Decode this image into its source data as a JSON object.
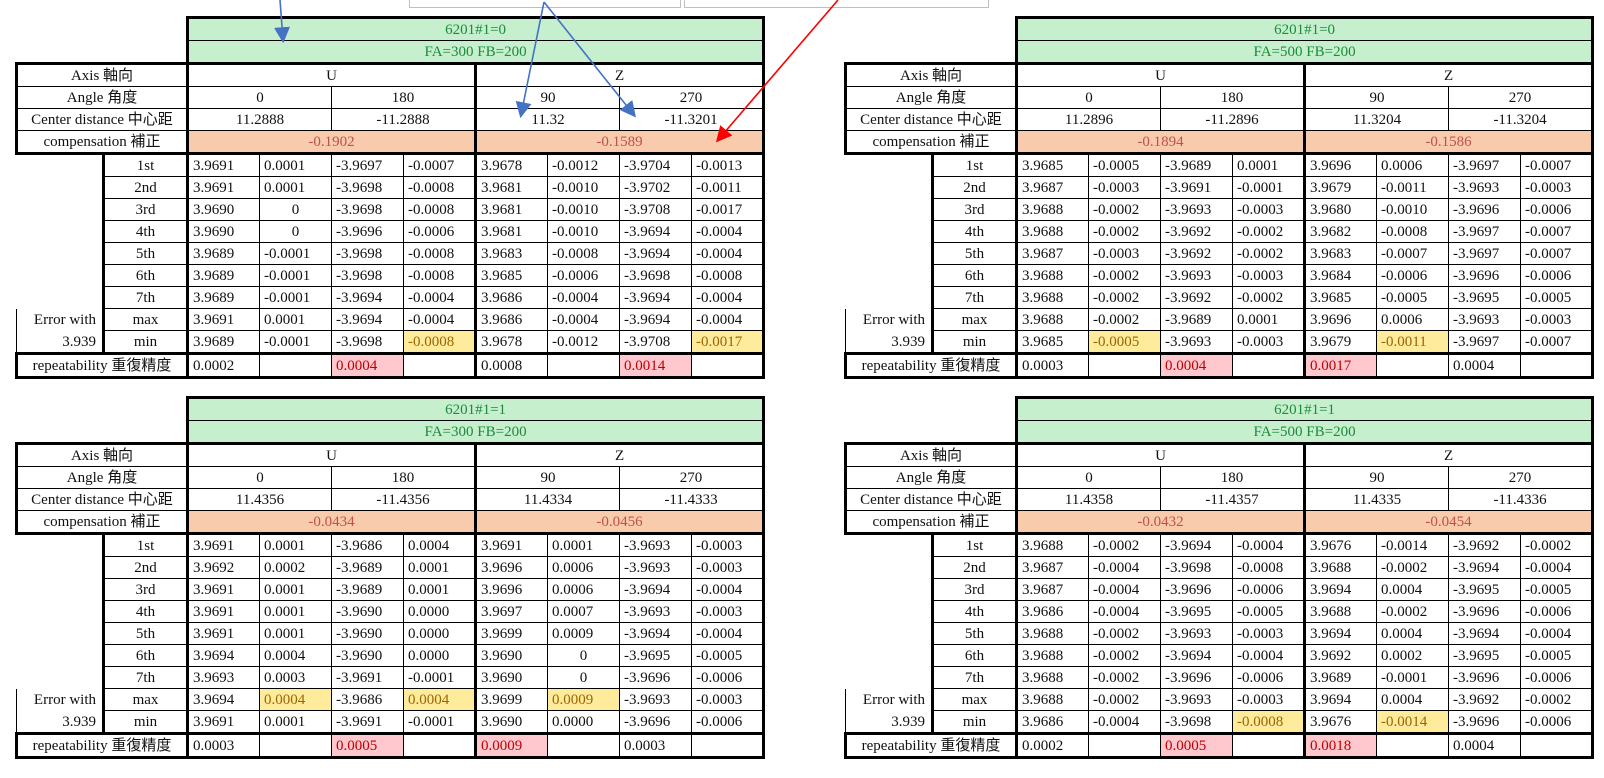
{
  "tables": [
    {
      "param": "6201#1=0",
      "feed": "FA=300 FB=200",
      "axis_label": "Axis 軸向",
      "angle_label": "Angle 角度",
      "center_label": "Center distance 中心距",
      "comp_label": "compensation 補正",
      "error_label": "Error with",
      "error_value": "3.939",
      "repeat_label": "repeatability 重復精度",
      "axes": [
        "U",
        "Z"
      ],
      "angles": [
        "0",
        "180",
        "90",
        "270"
      ],
      "center": [
        "11.2888",
        "-11.2888",
        "11.32",
        "-11.3201"
      ],
      "comp": [
        "-0.1902",
        "-0.1589"
      ],
      "rows": [
        {
          "label": "1st",
          "v": [
            "3.9691",
            "0.0001",
            "-3.9697",
            "-0.0007",
            "3.9678",
            "-0.0012",
            "-3.9704",
            "-0.0013"
          ]
        },
        {
          "label": "2nd",
          "v": [
            "3.9691",
            "0.0001",
            "-3.9698",
            "-0.0008",
            "3.9681",
            "-0.0010",
            "-3.9702",
            "-0.0011"
          ]
        },
        {
          "label": "3rd",
          "v": [
            "3.9690",
            "0",
            "-3.9698",
            "-0.0008",
            "3.9681",
            "-0.0010",
            "-3.9708",
            "-0.0017"
          ]
        },
        {
          "label": "4th",
          "v": [
            "3.9690",
            "0",
            "-3.9696",
            "-0.0006",
            "3.9681",
            "-0.0010",
            "-3.9694",
            "-0.0004"
          ]
        },
        {
          "label": "5th",
          "v": [
            "3.9689",
            "-0.0001",
            "-3.9698",
            "-0.0008",
            "3.9683",
            "-0.0008",
            "-3.9694",
            "-0.0004"
          ]
        },
        {
          "label": "6th",
          "v": [
            "3.9689",
            "-0.0001",
            "-3.9698",
            "-0.0008",
            "3.9685",
            "-0.0006",
            "-3.9698",
            "-0.0008"
          ]
        },
        {
          "label": "7th",
          "v": [
            "3.9689",
            "-0.0001",
            "-3.9694",
            "-0.0004",
            "3.9686",
            "-0.0004",
            "-3.9694",
            "-0.0004"
          ]
        }
      ],
      "max": {
        "label": "max",
        "v": [
          "3.9691",
          "0.0001",
          "-3.9694",
          "-0.0004",
          "3.9686",
          "-0.0004",
          "-3.9694",
          "-0.0004"
        ]
      },
      "min": {
        "label": "min",
        "v": [
          "3.9689",
          "-0.0001",
          "-3.9698",
          "-0.0008",
          "3.9678",
          "-0.0012",
          "-3.9708",
          "-0.0017"
        ]
      },
      "repeat": [
        "0.0002",
        "0.0004",
        "0.0008",
        "0.0014"
      ]
    },
    {
      "param": "6201#1=0",
      "feed": "FA=500 FB=200",
      "axis_label": "Axis 軸向",
      "angle_label": "Angle 角度",
      "center_label": "Center distance 中心距",
      "comp_label": "compensation 補正",
      "error_label": "Error with",
      "error_value": "3.939",
      "repeat_label": "repeatability 重復精度",
      "axes": [
        "U",
        "Z"
      ],
      "angles": [
        "0",
        "180",
        "90",
        "270"
      ],
      "center": [
        "11.2896",
        "-11.2896",
        "11.3204",
        "-11.3204"
      ],
      "comp": [
        "-0.1894",
        "-0.1586"
      ],
      "rows": [
        {
          "label": "1st",
          "v": [
            "3.9685",
            "-0.0005",
            "-3.9689",
            "0.0001",
            "3.9696",
            "0.0006",
            "-3.9697",
            "-0.0007"
          ]
        },
        {
          "label": "2nd",
          "v": [
            "3.9687",
            "-0.0003",
            "-3.9691",
            "-0.0001",
            "3.9679",
            "-0.0011",
            "-3.9693",
            "-0.0003"
          ]
        },
        {
          "label": "3rd",
          "v": [
            "3.9688",
            "-0.0002",
            "-3.9693",
            "-0.0003",
            "3.9680",
            "-0.0010",
            "-3.9696",
            "-0.0006"
          ]
        },
        {
          "label": "4th",
          "v": [
            "3.9688",
            "-0.0002",
            "-3.9692",
            "-0.0002",
            "3.9682",
            "-0.0008",
            "-3.9697",
            "-0.0007"
          ]
        },
        {
          "label": "5th",
          "v": [
            "3.9687",
            "-0.0003",
            "-3.9692",
            "-0.0002",
            "3.9683",
            "-0.0007",
            "-3.9697",
            "-0.0007"
          ]
        },
        {
          "label": "6th",
          "v": [
            "3.9688",
            "-0.0002",
            "-3.9693",
            "-0.0003",
            "3.9684",
            "-0.0006",
            "-3.9696",
            "-0.0006"
          ]
        },
        {
          "label": "7th",
          "v": [
            "3.9688",
            "-0.0002",
            "-3.9692",
            "-0.0002",
            "3.9685",
            "-0.0005",
            "-3.9695",
            "-0.0005"
          ]
        }
      ],
      "max": {
        "label": "max",
        "v": [
          "3.9688",
          "-0.0002",
          "-3.9689",
          "0.0001",
          "3.9696",
          "0.0006",
          "-3.9693",
          "-0.0003"
        ]
      },
      "min": {
        "label": "min",
        "v": [
          "3.9685",
          "-0.0005",
          "-3.9693",
          "-0.0003",
          "3.9679",
          "-0.0011",
          "-3.9697",
          "-0.0007"
        ]
      },
      "repeat": [
        "0.0003",
        "0.0004",
        "0.0017",
        "0.0004"
      ]
    },
    {
      "param": "6201#1=1",
      "feed": "FA=300 FB=200",
      "axis_label": "Axis 軸向",
      "angle_label": "Angle 角度",
      "center_label": "Center distance 中心距",
      "comp_label": "compensation 補正",
      "error_label": "Error with",
      "error_value": "3.939",
      "repeat_label": "repeatability 重復精度",
      "axes": [
        "U",
        "Z"
      ],
      "angles": [
        "0",
        "180",
        "90",
        "270"
      ],
      "center": [
        "11.4356",
        "-11.4356",
        "11.4334",
        "-11.4333"
      ],
      "comp": [
        "-0.0434",
        "-0.0456"
      ],
      "rows": [
        {
          "label": "1st",
          "v": [
            "3.9691",
            "0.0001",
            "-3.9686",
            "0.0004",
            "3.9691",
            "0.0001",
            "-3.9693",
            "-0.0003"
          ]
        },
        {
          "label": "2nd",
          "v": [
            "3.9692",
            "0.0002",
            "-3.9689",
            "0.0001",
            "3.9696",
            "0.0006",
            "-3.9693",
            "-0.0003"
          ]
        },
        {
          "label": "3rd",
          "v": [
            "3.9691",
            "0.0001",
            "-3.9689",
            "0.0001",
            "3.9696",
            "0.0006",
            "-3.9694",
            "-0.0004"
          ]
        },
        {
          "label": "4th",
          "v": [
            "3.9691",
            "0.0001",
            "-3.9690",
            "0.0000",
            "3.9697",
            "0.0007",
            "-3.9693",
            "-0.0003"
          ]
        },
        {
          "label": "5th",
          "v": [
            "3.9691",
            "0.0001",
            "-3.9690",
            "0.0000",
            "3.9699",
            "0.0009",
            "-3.9694",
            "-0.0004"
          ]
        },
        {
          "label": "6th",
          "v": [
            "3.9694",
            "0.0004",
            "-3.9690",
            "0.0000",
            "3.9690",
            "0",
            "-3.9695",
            "-0.0005"
          ]
        },
        {
          "label": "7th",
          "v": [
            "3.9693",
            "0.0003",
            "-3.9691",
            "-0.0001",
            "3.9690",
            "0",
            "-3.9696",
            "-0.0006"
          ]
        }
      ],
      "max": {
        "label": "max",
        "v": [
          "3.9694",
          "0.0004",
          "-3.9686",
          "0.0004",
          "3.9699",
          "0.0009",
          "-3.9693",
          "-0.0003"
        ]
      },
      "min": {
        "label": "min",
        "v": [
          "3.9691",
          "0.0001",
          "-3.9691",
          "-0.0001",
          "3.9690",
          "0.0000",
          "-3.9696",
          "-0.0006"
        ]
      },
      "repeat": [
        "0.0003",
        "0.0005",
        "0.0009",
        "0.0003"
      ]
    },
    {
      "param": "6201#1=1",
      "feed": "FA=500 FB=200",
      "axis_label": "Axis 軸向",
      "angle_label": "Angle 角度",
      "center_label": "Center distance 中心距",
      "comp_label": "compensation 補正",
      "error_label": "Error with",
      "error_value": "3.939",
      "repeat_label": "repeatability 重復精度",
      "axes": [
        "U",
        "Z"
      ],
      "angles": [
        "0",
        "180",
        "90",
        "270"
      ],
      "center": [
        "11.4358",
        "-11.4357",
        "11.4335",
        "-11.4336"
      ],
      "comp": [
        "-0.0432",
        "-0.0454"
      ],
      "rows": [
        {
          "label": "1st",
          "v": [
            "3.9688",
            "-0.0002",
            "-3.9694",
            "-0.0004",
            "3.9676",
            "-0.0014",
            "-3.9692",
            "-0.0002"
          ]
        },
        {
          "label": "2nd",
          "v": [
            "3.9687",
            "-0.0004",
            "-3.9698",
            "-0.0008",
            "3.9688",
            "-0.0002",
            "-3.9694",
            "-0.0004"
          ]
        },
        {
          "label": "3rd",
          "v": [
            "3.9687",
            "-0.0004",
            "-3.9696",
            "-0.0006",
            "3.9694",
            "0.0004",
            "-3.9695",
            "-0.0005"
          ]
        },
        {
          "label": "4th",
          "v": [
            "3.9686",
            "-0.0004",
            "-3.9695",
            "-0.0005",
            "3.9688",
            "-0.0002",
            "-3.9696",
            "-0.0006"
          ]
        },
        {
          "label": "5th",
          "v": [
            "3.9688",
            "-0.0002",
            "-3.9693",
            "-0.0003",
            "3.9694",
            "0.0004",
            "-3.9694",
            "-0.0004"
          ]
        },
        {
          "label": "6th",
          "v": [
            "3.9688",
            "-0.0002",
            "-3.9694",
            "-0.0004",
            "3.9692",
            "0.0002",
            "-3.9695",
            "-0.0005"
          ]
        },
        {
          "label": "7th",
          "v": [
            "3.9688",
            "-0.0002",
            "-3.9696",
            "-0.0006",
            "3.9689",
            "-0.0001",
            "-3.9696",
            "-0.0006"
          ]
        }
      ],
      "max": {
        "label": "max",
        "v": [
          "3.9688",
          "-0.0002",
          "-3.9693",
          "-0.0003",
          "3.9694",
          "0.0004",
          "-3.9692",
          "-0.0002"
        ]
      },
      "min": {
        "label": "min",
        "v": [
          "3.9686",
          "-0.0004",
          "-3.9698",
          "-0.0008",
          "3.9676",
          "-0.0014",
          "-3.9696",
          "-0.0006"
        ]
      },
      "repeat": [
        "0.0002",
        "0.0005",
        "0.0018",
        "0.0004"
      ]
    }
  ],
  "colors": {
    "header_green": "#c6efce",
    "header_text": "#1e8b3c",
    "compensation_orange": "#f8cbad",
    "highlight_yellow": "#ffeb9c",
    "highlight_red": "#ffc7ce",
    "arrow_blue": "#4472c4",
    "arrow_red": "#ff0000"
  }
}
